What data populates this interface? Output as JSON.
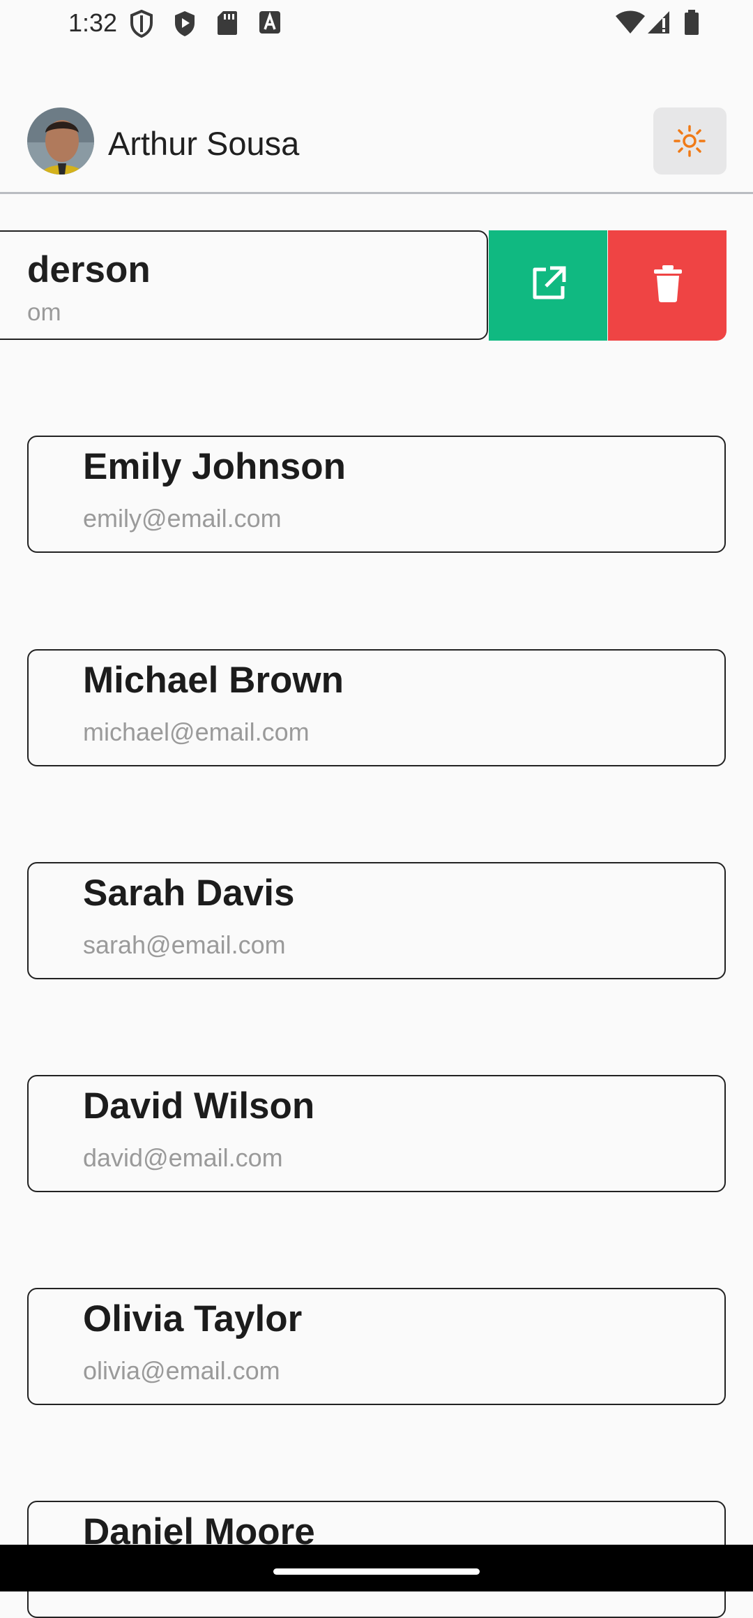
{
  "status_bar": {
    "time": "1:32",
    "icons": [
      "shield-icon",
      "play-protect-icon",
      "sd-card-icon",
      "font-icon",
      "wifi-icon",
      "signal-icon",
      "battery-icon"
    ]
  },
  "header": {
    "user_name": "Arthur Sousa",
    "theme_button_icon": "sun-icon"
  },
  "swiped_item": {
    "name_visible": "derson",
    "email_visible": "om",
    "actions": [
      {
        "icon": "external-link-icon",
        "color": "#10b981"
      },
      {
        "icon": "trash-icon",
        "color": "#ef4444"
      }
    ]
  },
  "contacts": [
    {
      "name": "Emily Johnson",
      "email": "emily@email.com"
    },
    {
      "name": "Michael Brown",
      "email": "michael@email.com"
    },
    {
      "name": "Sarah Davis",
      "email": "sarah@email.com"
    },
    {
      "name": "David Wilson",
      "email": "david@email.com"
    },
    {
      "name": "Olivia Taylor",
      "email": "olivia@email.com"
    },
    {
      "name": "Daniel Moore",
      "email": ""
    }
  ],
  "colors": {
    "background": "#fafafa",
    "accent_orange": "#f07a16",
    "edit_green": "#10b981",
    "delete_red": "#ef4444"
  }
}
